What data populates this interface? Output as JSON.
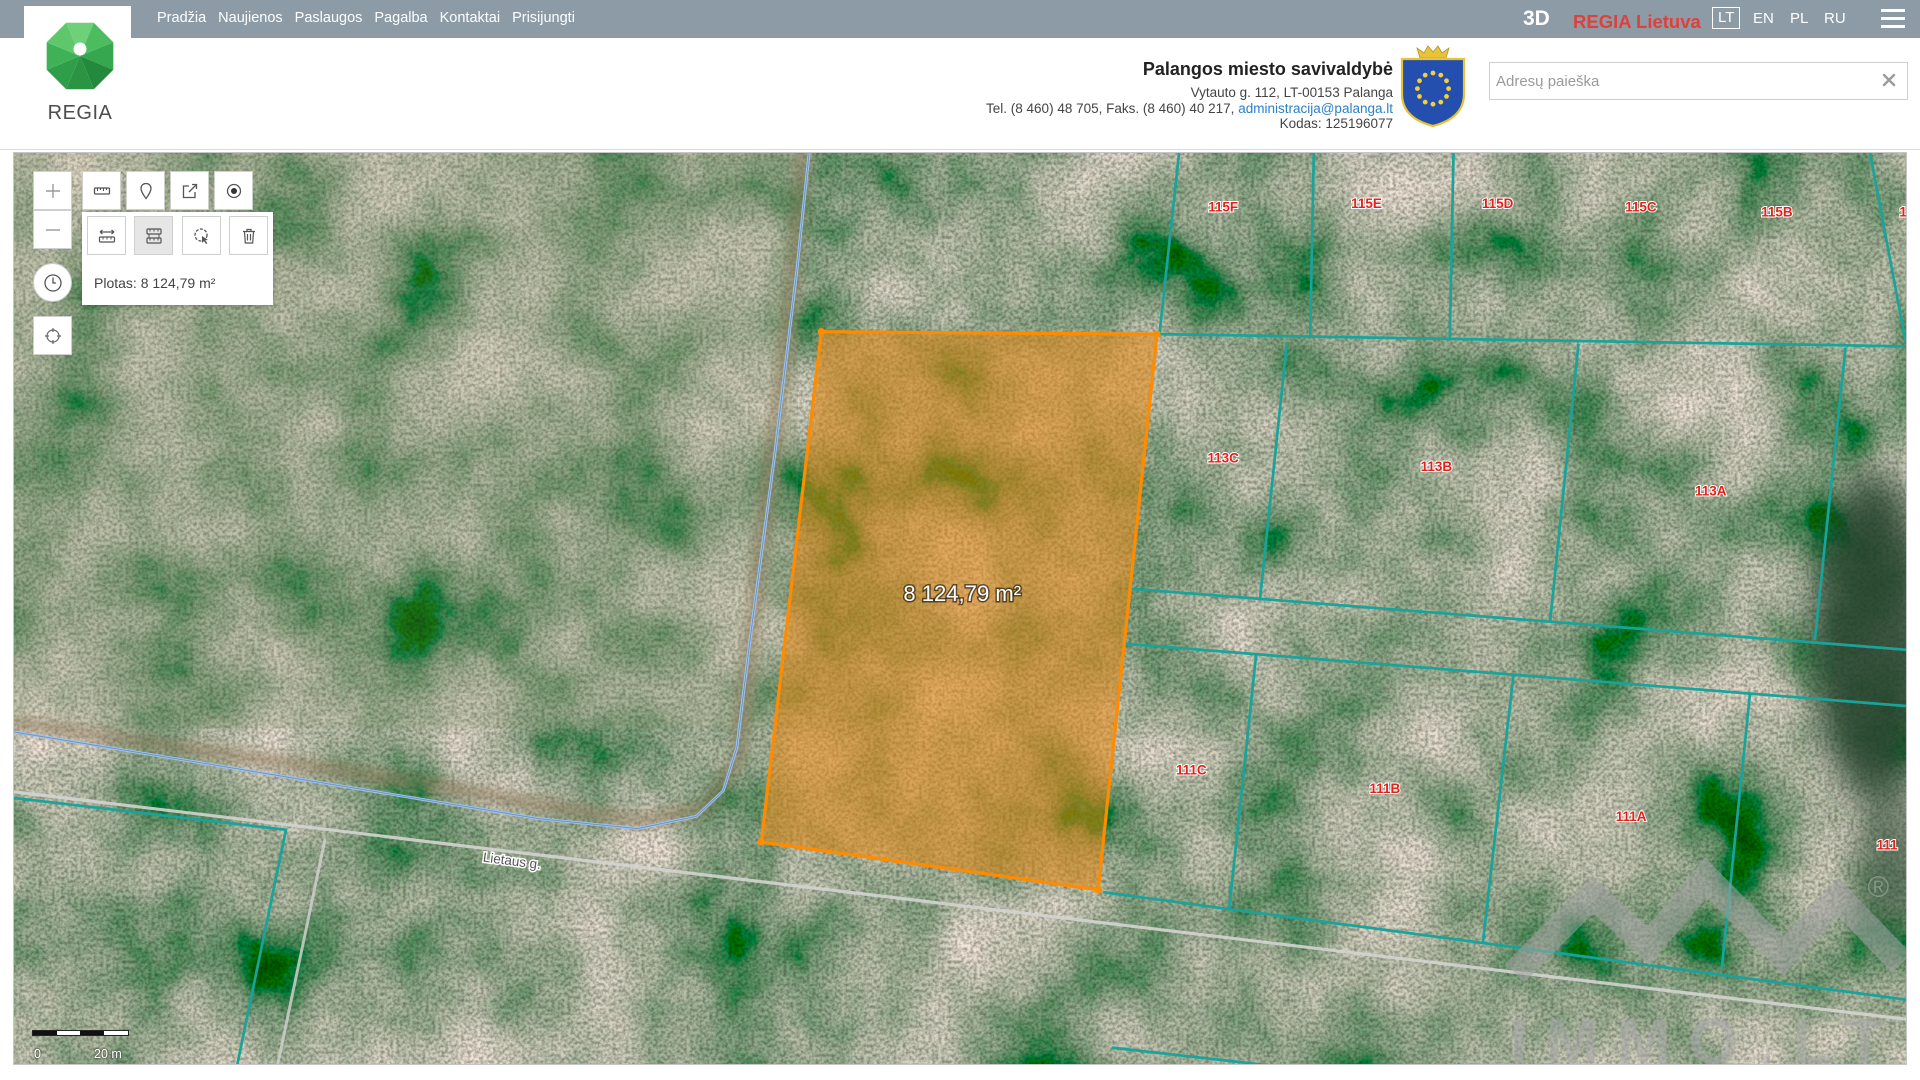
{
  "topbar": {
    "nav": [
      "Pradžia",
      "Naujienos",
      "Paslaugos",
      "Pagalba",
      "Kontaktai",
      "Prisijungti"
    ],
    "mode_3d": "3D",
    "brand": "REGIA Lietuva",
    "languages": [
      "LT",
      "EN",
      "PL",
      "RU"
    ],
    "active_language": "LT",
    "menu_icon": "hamburger-icon",
    "background_color": "#8c9ba6",
    "brand_color": "#e0403a"
  },
  "logo": {
    "text": "REGIA",
    "icon": "regia-gem-logo"
  },
  "municipality": {
    "name": "Palangos miesto savivaldybė",
    "address": "Vytauto g. 112, LT-00153 Palanga",
    "contacts": "Tel. (8 460) 48 705, Faks. (8 460) 40 217,",
    "email": "administracija@palanga.lt",
    "code": "Kodas: 125196077",
    "emblem": "coat-of-arms"
  },
  "search": {
    "placeholder": "Adresų paieška",
    "clear_icon": "close-icon"
  },
  "map_tools": {
    "zoom_in_icon": "plus-icon",
    "zoom_out_icon": "minus-icon",
    "toolbar_icons": [
      "ruler-icon",
      "pin-icon",
      "share-icon",
      "target-icon"
    ],
    "measure_icons": [
      "measure-distance-icon",
      "measure-area-icon",
      "measure-radius-icon",
      "trash-icon"
    ],
    "active_tool": "measure-area-icon",
    "history_icon": "clock-icon",
    "locate_icon": "locate-icon"
  },
  "measurement": {
    "panel_text": "Plotas: 8 124,79 m²",
    "polygon_label": "8 124,79 m²",
    "color": "#ff8c00"
  },
  "map": {
    "parcel_labels": [
      "115F",
      "115E",
      "115D",
      "115C",
      "115B",
      "1",
      "113C",
      "113B",
      "113A",
      "111C",
      "111B",
      "111A",
      "111"
    ],
    "street_label": "Lietaus g.",
    "parcel_line_color": "#1aa39a",
    "parcel_label_color": "#e3211c"
  },
  "scale_bar": {
    "start": "0",
    "end": "20 m"
  },
  "watermark": {
    "text": "IMMO.LT",
    "mark": "®"
  }
}
